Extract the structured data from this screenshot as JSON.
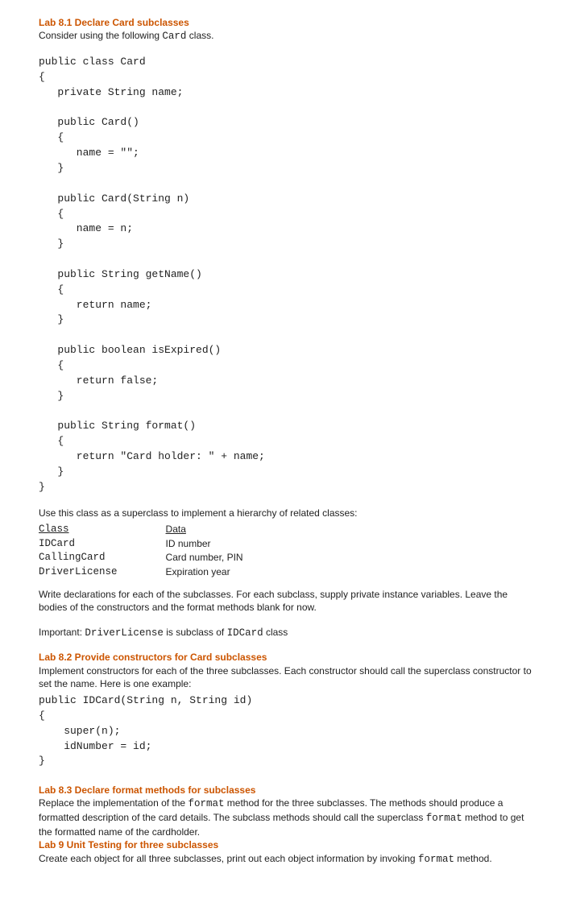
{
  "lab81": {
    "title": "Lab 8.1 Declare Card subclasses",
    "intro_pre": "Consider using the following ",
    "intro_code": "Card",
    "intro_post": " class.",
    "code": "public class Card\n{\n   private String name;\n\n   public Card()\n   {\n      name = \"\";\n   }\n\n   public Card(String n)\n   {\n      name = n;\n   }\n\n   public String getName()\n   {\n      return name;\n   }\n\n   public boolean isExpired()\n   {\n      return false;\n   }\n\n   public String format()\n   {\n      return \"Card holder: \" + name;\n   }\n}",
    "use_line": "Use this class as a superclass to implement a hierarchy of related classes:",
    "table": {
      "h_class": "Class",
      "h_data": "Data",
      "rows": [
        {
          "cls": "IDCard",
          "data": "ID number"
        },
        {
          "cls": "CallingCard",
          "data": "Card number, PIN"
        },
        {
          "cls": "DriverLicense",
          "data": "Expiration year"
        }
      ]
    },
    "write_decl": "Write declarations for each of the subclasses. For each subclass, supply private instance variables. Leave the bodies of the constructors and the format methods blank for now.",
    "important_pre": "Important: ",
    "important_code1": "DriverLicense",
    "important_mid": " is subclass of ",
    "important_code2": "IDCard",
    "important_post": " class"
  },
  "lab82": {
    "title": "Lab 8.2 Provide constructors for Card subclasses",
    "body": "Implement constructors for each of the three subclasses. Each constructor should call the superclass constructor to set the name. Here is one example:",
    "code": "public IDCard(String n, String id)\n{  \n    super(n);\n    idNumber = id;\n}"
  },
  "lab83": {
    "title": "Lab 8.3 Declare format methods for subclasses",
    "p1_a": "Replace the implementation of the ",
    "p1_code1": "format",
    "p1_b": " method for the three subclasses. The methods should produce a formatted description of the card details. The subclass methods should call the superclass ",
    "p1_code2": "format",
    "p1_c": " method to get the formatted name of the cardholder."
  },
  "lab9": {
    "title": "Lab 9 Unit Testing for three subclasses",
    "p_a": "Create each object for all three subclasses, print out each object information by invoking ",
    "p_code": "format",
    "p_b": " method."
  }
}
